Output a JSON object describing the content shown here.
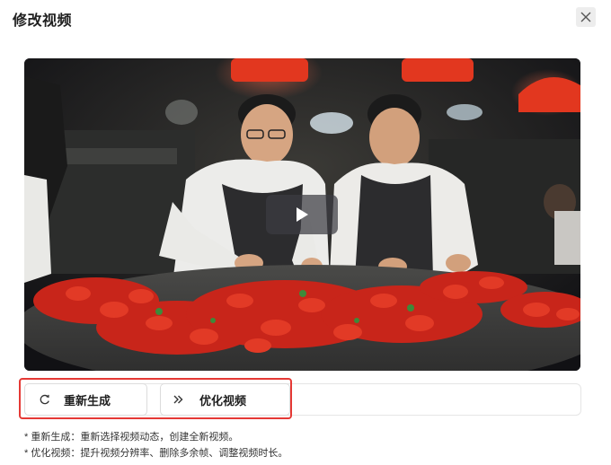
{
  "dialog": {
    "title": "修改视频",
    "close_icon": "close-icon"
  },
  "video": {
    "play_icon": "play-icon"
  },
  "actions": {
    "regenerate_label": "重新生成",
    "regenerate_icon": "refresh-icon",
    "optimize_label": "优化视频",
    "optimize_icon": "double-chevron-icon"
  },
  "notes": [
    "* 重新生成：重新选择视频动态，创建全新视频。",
    "* 优化视频：提升视频分辨率、删除多余帧、调整视频时长。"
  ],
  "colors": {
    "highlight": "#e53935",
    "lamp": "#e2371f"
  }
}
